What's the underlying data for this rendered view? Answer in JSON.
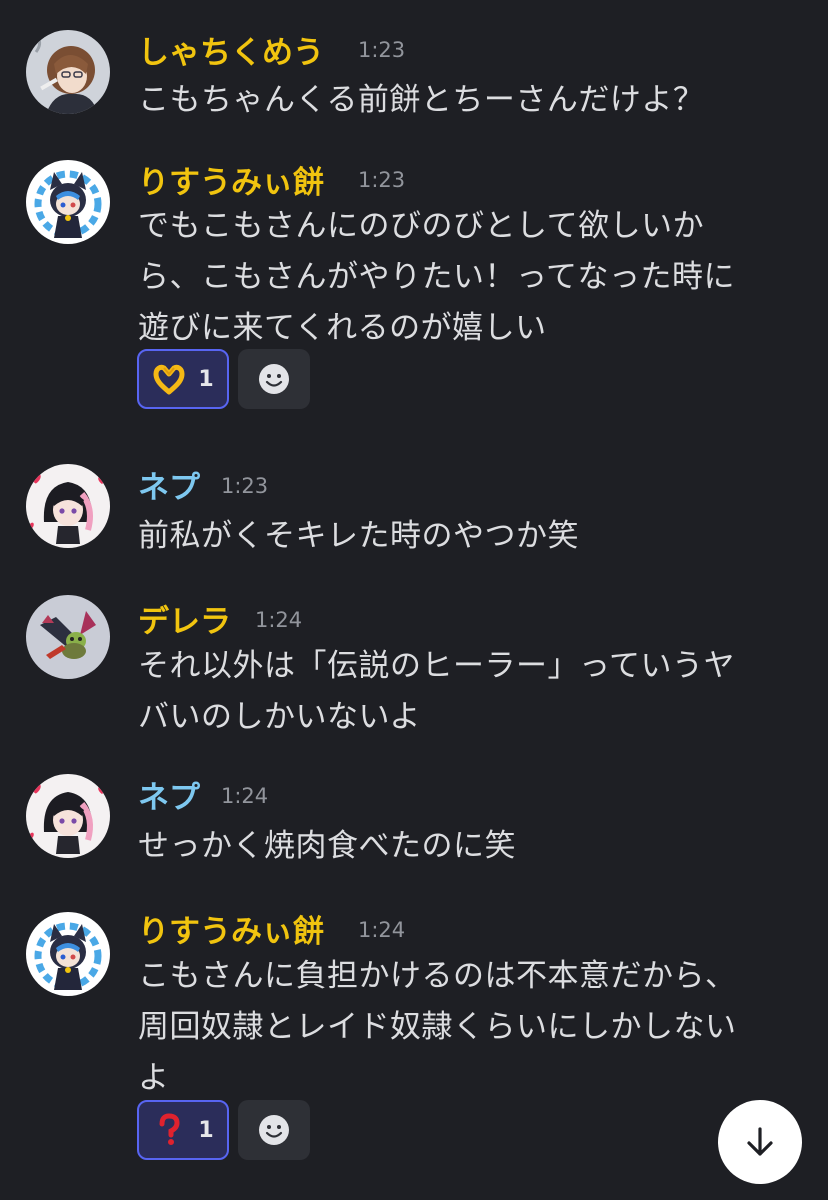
{
  "colors": {
    "background": "#1e1f24",
    "name_gold": "#f1c40f",
    "name_blue": "#7ec8f0",
    "text": "#dcdde0",
    "timestamp": "#92959c",
    "reaction_active_bg": "#2b2d5a",
    "reaction_active_border": "#5865f2"
  },
  "messages": [
    {
      "author": "しゃちくめう",
      "time": "1:23",
      "avatar_icon": "brown-hair-girl-avatar",
      "lines": [
        "こもちゃんくる前餅とちーさんだけよ？"
      ]
    },
    {
      "author": "りすうみぃ餅",
      "time": "1:23",
      "avatar_icon": "blue-hood-character-avatar",
      "lines": [
        "でもこもさんにのびのびとして欲しいか",
        "ら、こもさんがやりたい！ってなった時に",
        "遊びに来てくれるのが嬉しい"
      ],
      "reactions": [
        {
          "emoji": "heart-hands-emoji",
          "count": "1"
        }
      ]
    },
    {
      "author": "ネプ",
      "time": "1:23",
      "avatar_icon": "black-pink-hair-girl-avatar",
      "lines": [
        "前私がくそキレた時のやつか笑"
      ]
    },
    {
      "author": "デレラ",
      "time": "1:24",
      "avatar_icon": "fantasy-creature-avatar",
      "lines": [
        "それ以外は「伝説のヒーラー」っていうヤ",
        "バいのしかいないよ"
      ]
    },
    {
      "author": "ネプ",
      "time": "1:24",
      "avatar_icon": "black-pink-hair-girl-avatar",
      "lines": [
        "せっかく焼肉食べたのに笑"
      ]
    },
    {
      "author": "りすうみぃ餅",
      "time": "1:24",
      "avatar_icon": "blue-hood-character-avatar",
      "lines": [
        "こもさんに負担かけるのは不本意だから、",
        "周回奴隷とレイド奴隷くらいにしかしない",
        "よ"
      ],
      "reactions": [
        {
          "emoji": "red-question-mark-emoji",
          "count": "1"
        }
      ]
    }
  ],
  "add_reaction_icon": "smiley-face-icon",
  "jump_to_bottom_icon": "arrow-down-icon"
}
